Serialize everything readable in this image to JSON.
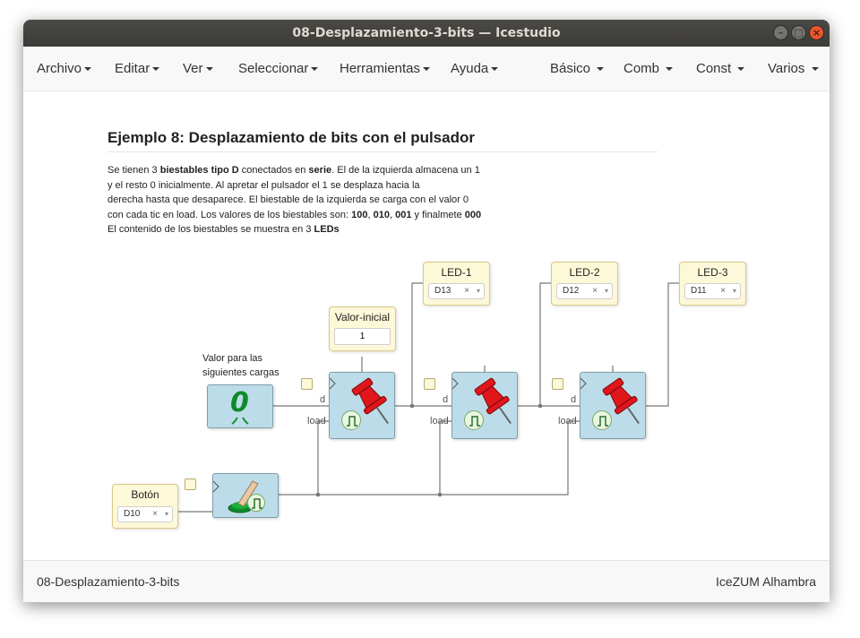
{
  "window": {
    "title": "08-Desplazamiento-3-bits — Icestudio"
  },
  "menubar": {
    "left": [
      {
        "label": "Archivo"
      },
      {
        "label": "Editar"
      },
      {
        "label": "Ver"
      },
      {
        "label": "Seleccionar"
      },
      {
        "label": "Herramientas"
      },
      {
        "label": "Ayuda"
      }
    ],
    "right": [
      {
        "label": "Básico"
      },
      {
        "label": "Comb"
      },
      {
        "label": "Const"
      },
      {
        "label": "Varios"
      }
    ]
  },
  "document": {
    "title": "Ejemplo 8: Desplazamiento de bits con el pulsador",
    "description": [
      [
        {
          "t": "Se tienen 3 "
        },
        {
          "t": "biestables tipo D",
          "b": true
        },
        {
          "t": " conectados en "
        },
        {
          "t": "serie",
          "b": true
        },
        {
          "t": ". El de la izquierda almacena un 1"
        }
      ],
      [
        {
          "t": "y el resto 0 inicialmente. Al apretar el pulsador el 1 se desplaza hacia la"
        }
      ],
      [
        {
          "t": "derecha hasta que desaparece. El biestable de la izquierda se carga con el valor 0"
        }
      ],
      [
        {
          "t": "con cada tic en load. Los valores de los biestables son: "
        },
        {
          "t": "100",
          "b": true
        },
        {
          "t": ", "
        },
        {
          "t": "010",
          "b": true
        },
        {
          "t": ", "
        },
        {
          "t": "001",
          "b": true
        },
        {
          "t": " y finalmete "
        },
        {
          "t": "000",
          "b": true
        }
      ],
      [
        {
          "t": "El contenido de los biestables se muestra en 3 "
        },
        {
          "t": "LEDs",
          "b": true
        }
      ]
    ]
  },
  "blocks": {
    "led1": {
      "label": "LED-1",
      "pin": "D13"
    },
    "led2": {
      "label": "LED-2",
      "pin": "D12"
    },
    "led3": {
      "label": "LED-3",
      "pin": "D11"
    },
    "boton": {
      "label": "Botón",
      "pin": "D10"
    },
    "valor_inicial": {
      "label": "Valor-inicial",
      "value": "1"
    },
    "next_value_note": {
      "line1": "Valor para las",
      "line2": "siguientes cargas"
    },
    "zero_constant": {
      "glyph": "0"
    },
    "pins": {
      "d": "d",
      "load": "load"
    },
    "select_clear": "×",
    "select_dropdown": "▾"
  },
  "colors": {
    "io_block": "#fdf8d8",
    "module_block": "#bcdce9",
    "wire": "#777777",
    "pin_red": "#e0161b",
    "led_green": "#0f8a2a"
  },
  "statusbar": {
    "left": "08-Desplazamiento-3-bits",
    "right": "IceZUM Alhambra"
  }
}
